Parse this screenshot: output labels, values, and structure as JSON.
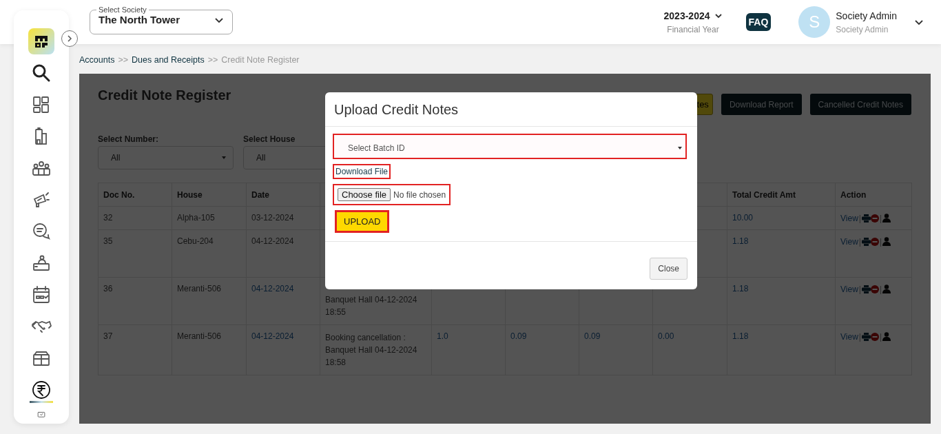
{
  "header": {
    "society": {
      "label": "Select Society",
      "value": "The North Tower"
    },
    "year": {
      "value": "2023-2024",
      "label": "Financial Year"
    },
    "faq": "FAQ",
    "user": {
      "initial": "S",
      "name": "Society Admin",
      "role": "Society Admin"
    }
  },
  "sidebar": {
    "items": [
      {
        "selected": false
      },
      {
        "selected": false
      },
      {
        "selected": false
      },
      {
        "selected": false
      },
      {
        "selected": false
      },
      {
        "selected": false
      },
      {
        "selected": false
      },
      {
        "selected": false
      },
      {
        "selected": false
      },
      {
        "selected": false
      },
      {
        "selected": true
      },
      {
        "selected": false
      }
    ]
  },
  "breadcrumb": [
    {
      "label": "Accounts",
      "kind": "link"
    },
    {
      "label": ">>",
      "kind": "sep"
    },
    {
      "label": "Dues and Receipts",
      "kind": "link"
    },
    {
      "label": ">>",
      "kind": "sep"
    },
    {
      "label": "Credit Note Register",
      "kind": "current"
    }
  ],
  "page": {
    "title": "Credit Note Register",
    "buttons": [
      {
        "label": "tes",
        "kind": "accent"
      },
      {
        "label": "Download Report",
        "kind": "dark"
      },
      {
        "label": "Cancelled Credit Notes",
        "kind": "dark"
      }
    ],
    "filters": [
      {
        "label": "Select Number:",
        "value": "All"
      },
      {
        "label": "Select House",
        "value": "All"
      }
    ],
    "table": {
      "columns": [
        "Doc No.",
        "House",
        "Date",
        null,
        null,
        null,
        null,
        null,
        "Total Credit Amt",
        "Action"
      ],
      "rows": [
        {
          "doc_no": "32",
          "house": "Alpha-105",
          "date": "03-12-2024",
          "total": "10.00",
          "view": "View",
          "separator": "|"
        },
        {
          "doc_no": "35",
          "house": "Cebu-204",
          "date": "04-12-2024",
          "total": "1.18",
          "view": "View",
          "separator": "|"
        },
        {
          "doc_no": "36",
          "house": "Meranti-506",
          "date": "04-12-2024",
          "column_4": [
            "Banquet Hall 04-12-2024",
            "18:55"
          ],
          "total": "1.18",
          "view": "View",
          "separator": "|"
        },
        {
          "doc_no": "37",
          "house": "Meranti-506",
          "date": "04-12-2024",
          "column_4": [
            "Booking cancellation :",
            "Banquet Hall 04-12-2024",
            "18:58"
          ],
          "column_5": "1.0",
          "column_6": "0.09",
          "column_7": "0.09",
          "column_8": "0.00",
          "total": "1.18",
          "view": "View",
          "separator": "|"
        }
      ]
    }
  },
  "modal": {
    "title": "Upload Credit Notes",
    "batch_placeholder": "Select Batch ID",
    "download_link": "Download File",
    "file_button": "Choose file",
    "file_status": "No file chosen",
    "upload_button": "UPLOAD",
    "close_button": "Close"
  }
}
